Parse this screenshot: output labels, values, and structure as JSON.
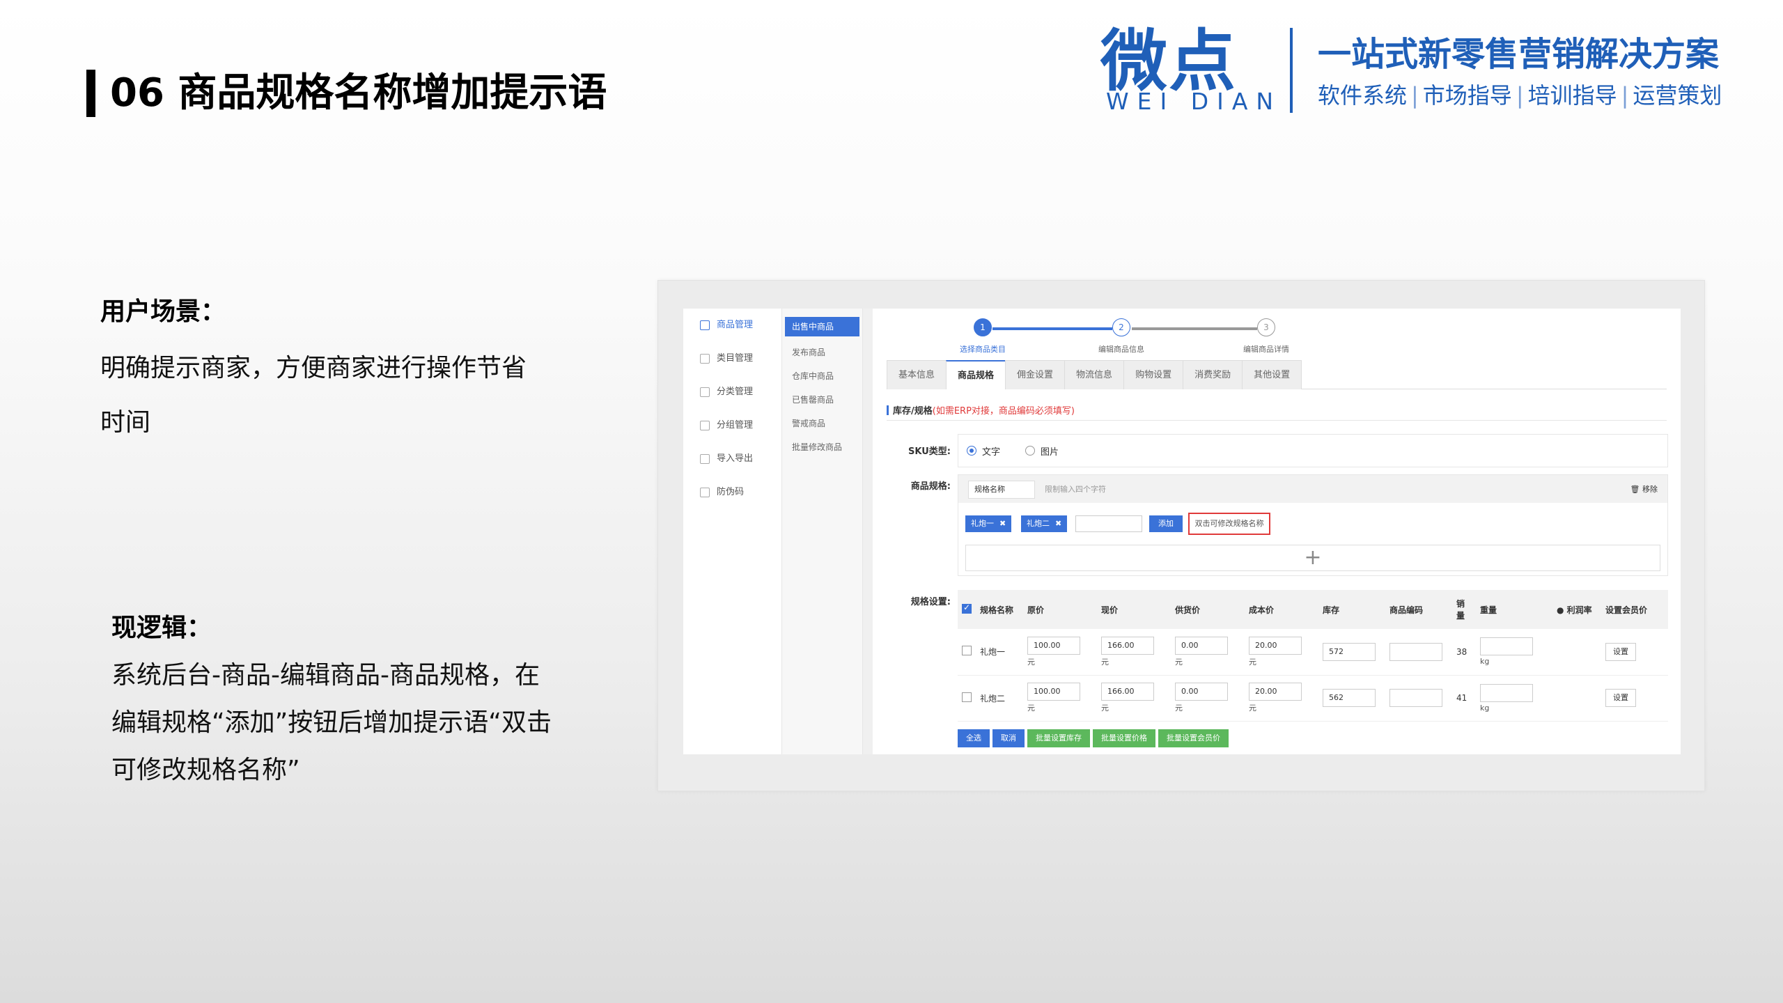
{
  "slide": {
    "title": "06 商品规格名称增加提示语",
    "logo": {
      "mark": "微点",
      "sub": "WEI DIAN",
      "slogan": "一站式新零售营销解决方案",
      "services": [
        "软件系统",
        "市场指导",
        "培训指导",
        "运营策划"
      ]
    },
    "scene": {
      "heading": "用户场景：",
      "body": "明确提示商家，方便商家进行操作节省时间"
    },
    "logic": {
      "heading": "现逻辑：",
      "body": "系统后台-商品-编辑商品-商品规格，在编辑规格“添加”按钮后增加提示语“双击可修改规格名称”"
    }
  },
  "app": {
    "nav1": [
      "商品管理",
      "类目管理",
      "分类管理",
      "分组管理",
      "导入导出",
      "防伪码"
    ],
    "nav2": [
      "出售中商品",
      "发布商品",
      "仓库中商品",
      "已售罄商品",
      "警戒商品",
      "批量修改商品"
    ],
    "steps": [
      {
        "num": "1",
        "label": "选择商品类目"
      },
      {
        "num": "2",
        "label": "编辑商品信息"
      },
      {
        "num": "3",
        "label": "编辑商品详情"
      }
    ],
    "tabs": [
      "基本信息",
      "商品规格",
      "佣金设置",
      "物流信息",
      "购物设置",
      "消费奖励",
      "其他设置"
    ],
    "section": {
      "title": "库存/规格",
      "warning": "(如需ERP对接，商品编码必须填写)"
    },
    "sku": {
      "label": "SKU类型:",
      "options": [
        "文字",
        "图片"
      ],
      "selected": "文字"
    },
    "spec": {
      "label": "商品规格:",
      "name_value": "规格名称",
      "hint": "限制输入四个字符",
      "remove": "移除",
      "tags": [
        "礼炮一",
        "礼炮二"
      ],
      "add_button": "添加",
      "new_hint": "双击可修改规格名称",
      "plus": "+"
    },
    "grid": {
      "label": "规格设置:",
      "headers": [
        "规格名称",
        "原价",
        "现价",
        "供货价",
        "成本价",
        "库存",
        "商品编码",
        "销量",
        "重量",
        "利润率",
        "设置会员价"
      ],
      "rows": [
        {
          "name": "礼炮一",
          "original": "100.00",
          "current": "166.00",
          "supply": "0.00",
          "cost": "20.00",
          "stock": "572",
          "code": "",
          "sales": "38",
          "weight": "",
          "unit_price": "元",
          "unit_weight": "kg",
          "action": "设置"
        },
        {
          "name": "礼炮二",
          "original": "100.00",
          "current": "166.00",
          "supply": "0.00",
          "cost": "20.00",
          "stock": "562",
          "code": "",
          "sales": "41",
          "weight": "",
          "unit_price": "元",
          "unit_weight": "kg",
          "action": "设置"
        }
      ]
    },
    "bottom_buttons": [
      "全选",
      "取消",
      "批量设置库存",
      "批量设置价格",
      "批量设置会员价"
    ]
  }
}
